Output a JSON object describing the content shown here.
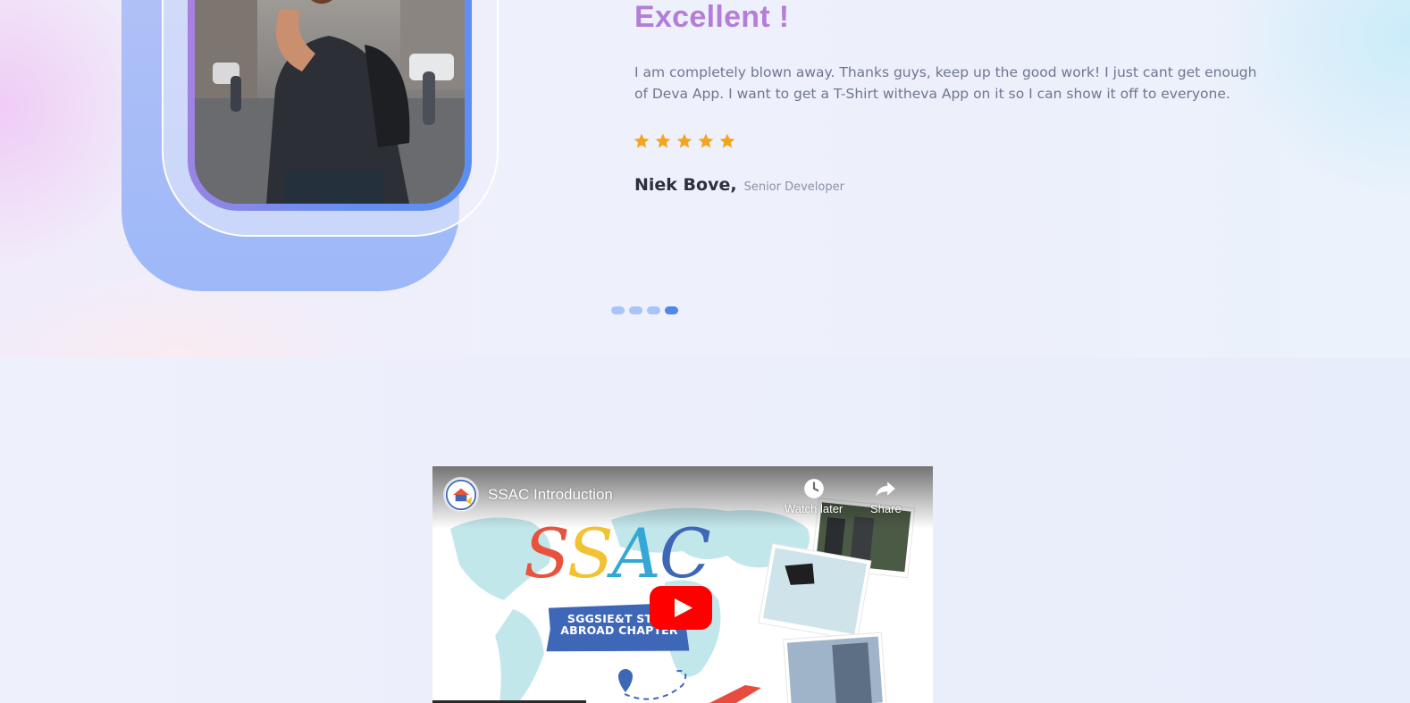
{
  "testimonial": {
    "rating_title": "Excellent !",
    "review_text": "I am completely blown away. Thanks guys, keep up the good work! I just cant get enough of Deva App. I want to get a T-Shirt witheva App on it so I can show it off to everyone.",
    "stars": 5,
    "star_color": "#f3a41d",
    "author_name": "Niek Bove,",
    "author_role": "Senior Developer",
    "slider_dots": 4,
    "active_dot": 4,
    "accent_color": "#b37ed8"
  },
  "video": {
    "title": "SSAC Introduction",
    "watch_later_label": "Watch later",
    "share_label": "Share",
    "logo_text": "SSAC",
    "banner_line1": "SGGSIE&T STUD",
    "banner_line2": "ABROAD CHAPTER",
    "play_icon": "youtube-play-icon",
    "play_color": "#ff0000"
  }
}
